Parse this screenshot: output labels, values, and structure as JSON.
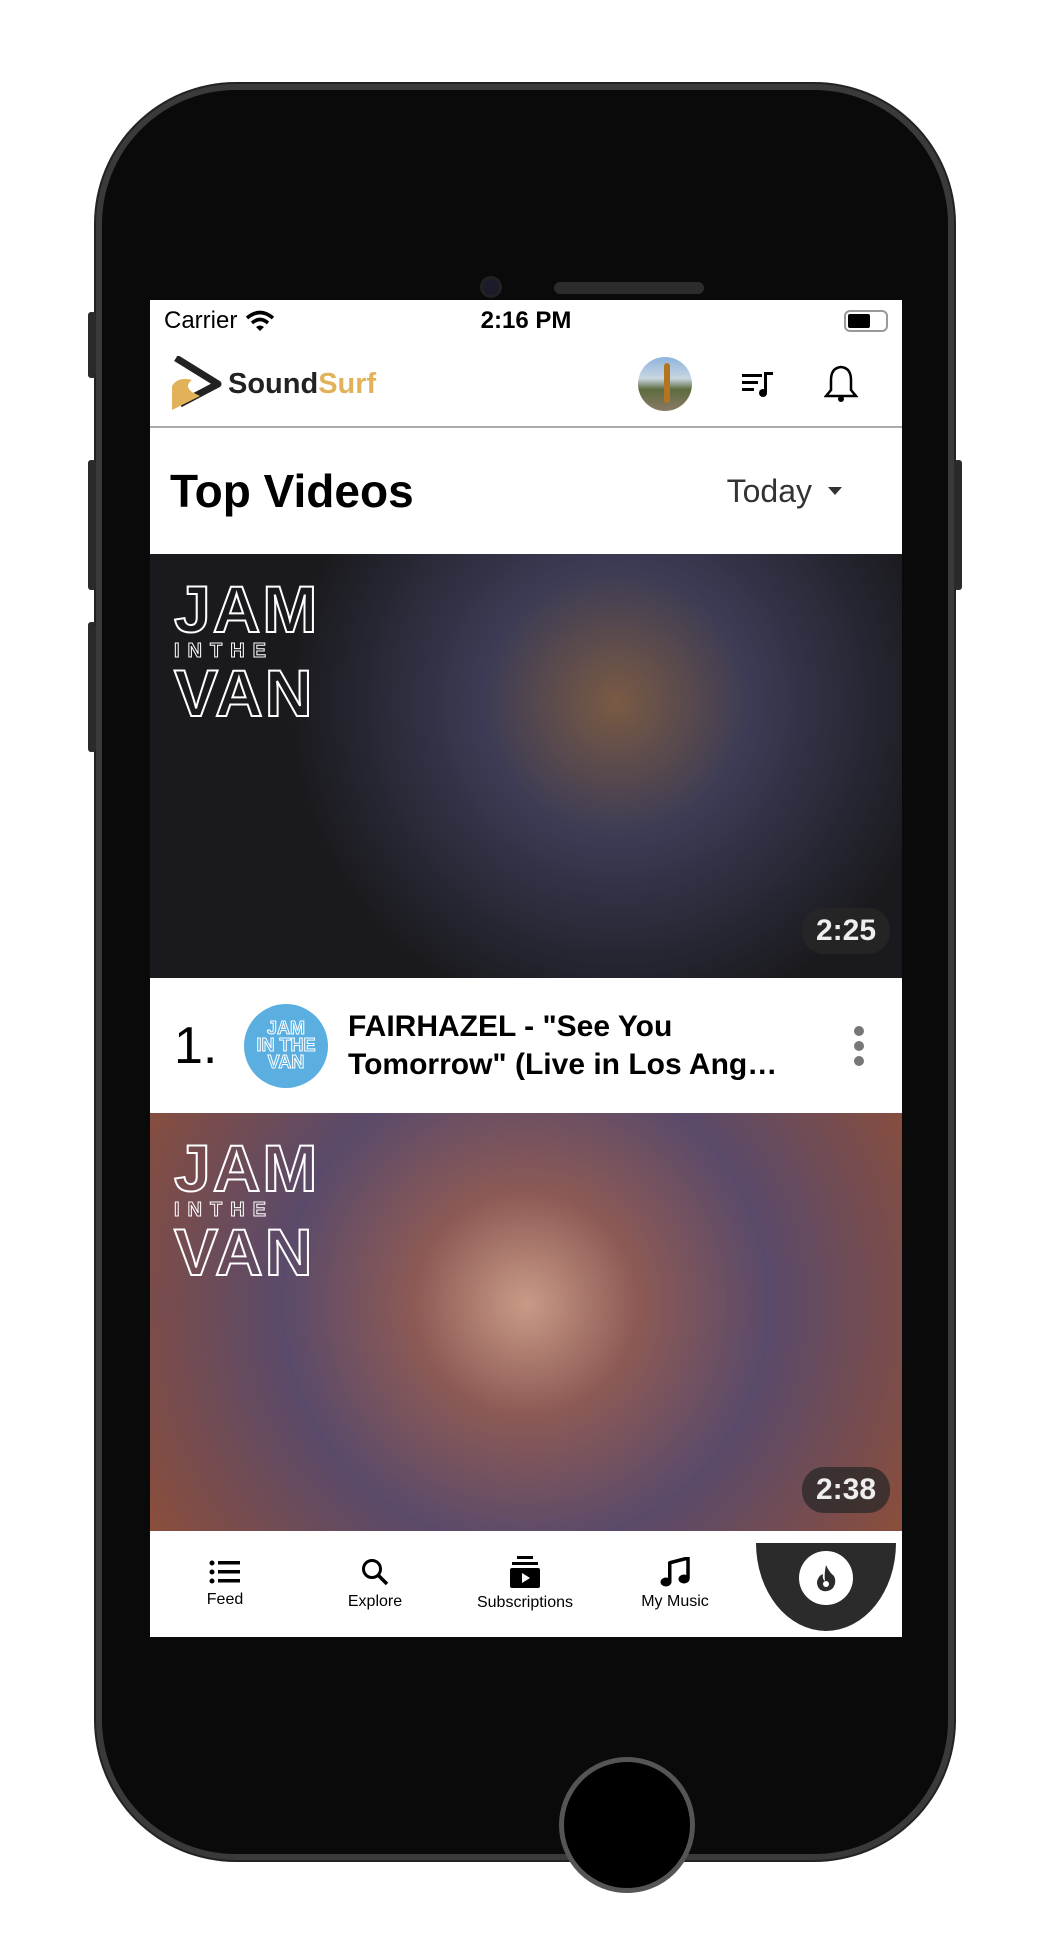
{
  "status": {
    "carrier": "Carrier",
    "time": "2:16 PM"
  },
  "header": {
    "brand_part1": "Sound",
    "brand_part2": "Surf",
    "brand_color": "#e2b25a"
  },
  "page": {
    "title": "Top Videos",
    "period": "Today"
  },
  "videos": [
    {
      "rank": "1.",
      "title": "FAIRHAZEL - \"See You Tomorrow\" (Live in Los Ang…",
      "duration": "2:25",
      "thumb_logo": "JAM IN THE VAN",
      "channel_logo": "JAM IN THE VAN"
    },
    {
      "duration": "2:38",
      "thumb_logo": "JAM IN THE VAN"
    }
  ],
  "nav": [
    {
      "label": "Feed",
      "icon": "list-icon"
    },
    {
      "label": "Explore",
      "icon": "search-icon"
    },
    {
      "label": "Subscriptions",
      "icon": "subscriptions-icon"
    },
    {
      "label": "My Music",
      "icon": "music-note-icon"
    }
  ],
  "fab": {
    "icon": "fire-icon",
    "color": "#2b2b2b"
  }
}
